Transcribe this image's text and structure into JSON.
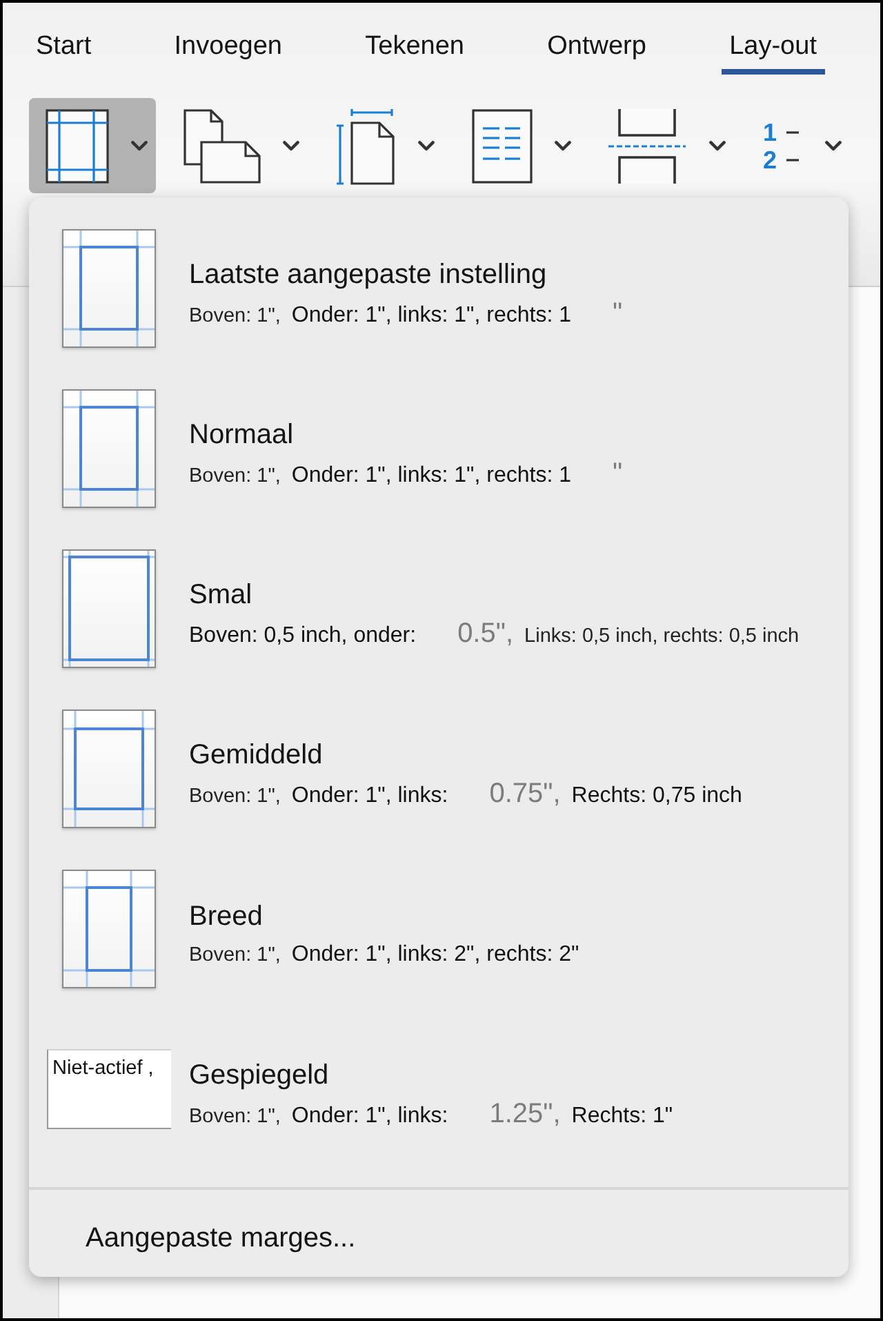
{
  "tabs": [
    {
      "label": "Start",
      "selected": false
    },
    {
      "label": "Invoegen",
      "selected": false
    },
    {
      "label": "Tekenen",
      "selected": false
    },
    {
      "label": "Ontwerp",
      "selected": false
    },
    {
      "label": "Lay-out",
      "selected": true
    }
  ],
  "toolbar": [
    {
      "kind": "margins",
      "selected": true
    },
    {
      "kind": "orientation",
      "selected": false
    },
    {
      "kind": "size",
      "selected": false
    },
    {
      "kind": "columns",
      "selected": false
    },
    {
      "kind": "breaks",
      "selected": false
    },
    {
      "kind": "line_numbers",
      "selected": false,
      "glyphs": [
        "1",
        "2"
      ]
    }
  ],
  "margins_menu": {
    "items": [
      {
        "kind": "last",
        "title": "Laatste aangepaste instelling",
        "details": [
          {
            "kind": "small",
            "text": "Boven: 1\","
          },
          {
            "kind": "normal",
            "text": "Onder: 1\", links: 1\", rechts: 1"
          },
          {
            "kind": "faded",
            "text": "\""
          }
        ]
      },
      {
        "kind": "normal",
        "title": "Normaal",
        "details": [
          {
            "kind": "small",
            "text": "Boven: 1\","
          },
          {
            "kind": "normal",
            "text": "Onder: 1\", links: 1\", rechts: 1"
          },
          {
            "kind": "faded",
            "text": "\""
          }
        ]
      },
      {
        "kind": "narrow",
        "title": "Smal",
        "details": [
          {
            "kind": "normal",
            "text": "Boven: 0,5 inch, onder:"
          },
          {
            "kind": "faded",
            "text": "0.5\","
          },
          {
            "kind": "small",
            "text": "Links: 0,5 inch, rechts: 0,5 inch"
          }
        ]
      },
      {
        "kind": "moderate",
        "title": "Gemiddeld",
        "details": [
          {
            "kind": "small",
            "text": "Boven: 1\","
          },
          {
            "kind": "normal",
            "text": "Onder: 1\", links:"
          },
          {
            "kind": "faded",
            "text": "0.75\","
          },
          {
            "kind": "normal",
            "text": "Rechts: 0,75 inch"
          }
        ]
      },
      {
        "kind": "wide",
        "title": "Breed",
        "details": [
          {
            "kind": "small",
            "text": "Boven: 1\","
          },
          {
            "kind": "normal",
            "text": "Onder: 1\", links: 2\", rechts: 2\""
          }
        ]
      },
      {
        "kind": "broken",
        "preview_text": "Niet-actief ,",
        "title": "Gespiegeld",
        "details": [
          {
            "kind": "small",
            "text": "Boven: 1\","
          },
          {
            "kind": "normal",
            "text": "Onder: 1\", links:"
          },
          {
            "kind": "faded",
            "text": "1.25\","
          },
          {
            "kind": "normal",
            "text": "Rechts: 1\""
          }
        ]
      }
    ],
    "footer": "Aangepaste marges..."
  }
}
